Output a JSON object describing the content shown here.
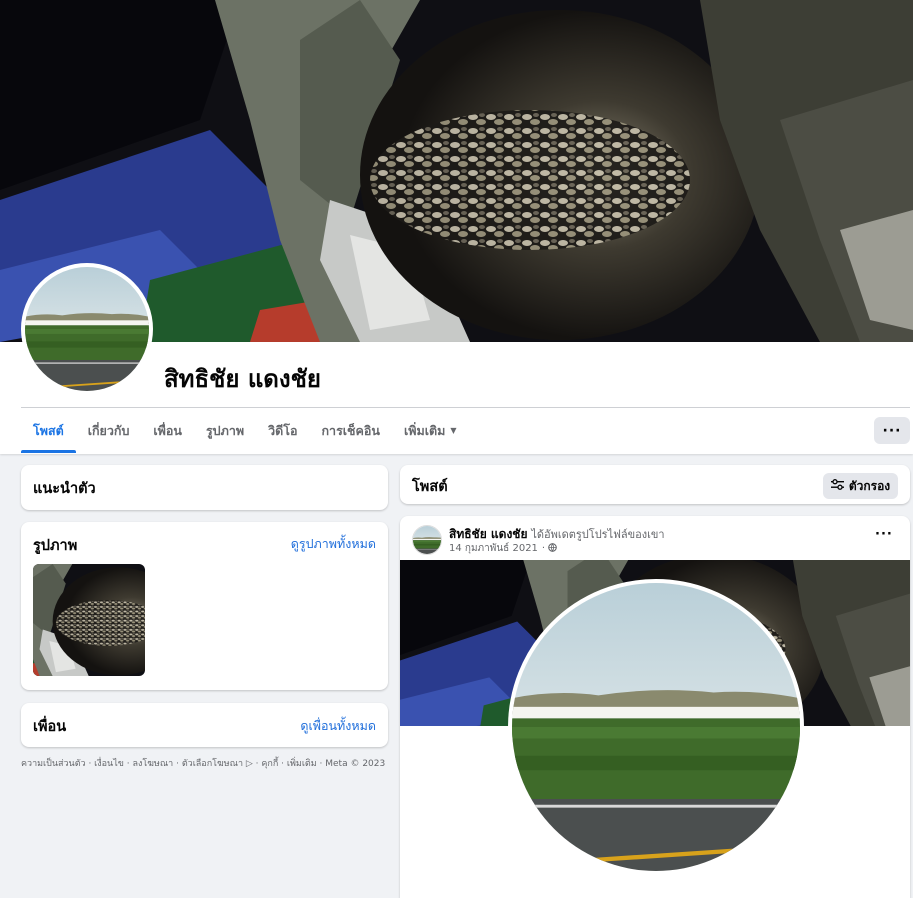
{
  "profile": {
    "name": "สิทธิชัย แดงชัย"
  },
  "tabs": [
    {
      "label": "โพสต์",
      "active": true
    },
    {
      "label": "เกี่ยวกับ"
    },
    {
      "label": "เพื่อน"
    },
    {
      "label": "รูปภาพ"
    },
    {
      "label": "วิดีโอ"
    },
    {
      "label": "การเช็คอิน"
    },
    {
      "label": "เพิ่มเติม",
      "caret": "▼"
    }
  ],
  "header": {
    "more_button": "···"
  },
  "intro": {
    "title": "แนะนำตัว"
  },
  "photos": {
    "title": "รูปภาพ",
    "see_all": "ดูรูปภาพทั้งหมด"
  },
  "friends": {
    "title": "เพื่อน",
    "see_all": "ดูเพื่อนทั้งหมด"
  },
  "footer": {
    "text": "ความเป็นส่วนตัว · เงื่อนไข · ลงโฆษณา · ตัวเลือกโฆษณา ▷ · คุกกี้ · เพิ่มเติม · Meta © 2023"
  },
  "posts_header": {
    "title": "โพสต์",
    "filter_label": "ตัวกรอง",
    "filter_icon": "sliders-icon"
  },
  "post": {
    "author": "สิทธิชัย แดงชัย",
    "action": "ได้อัพเดตรูปโปรไฟล์ของเขา",
    "timestamp": "14 กุมภาพันธ์ 2021",
    "privacy_icon": "globe-icon",
    "menu": "···"
  },
  "colors": {
    "accent": "#1b74e4",
    "link": "#216fdb",
    "page_bg": "#f0f2f5",
    "button_bg": "#e4e6eb"
  }
}
